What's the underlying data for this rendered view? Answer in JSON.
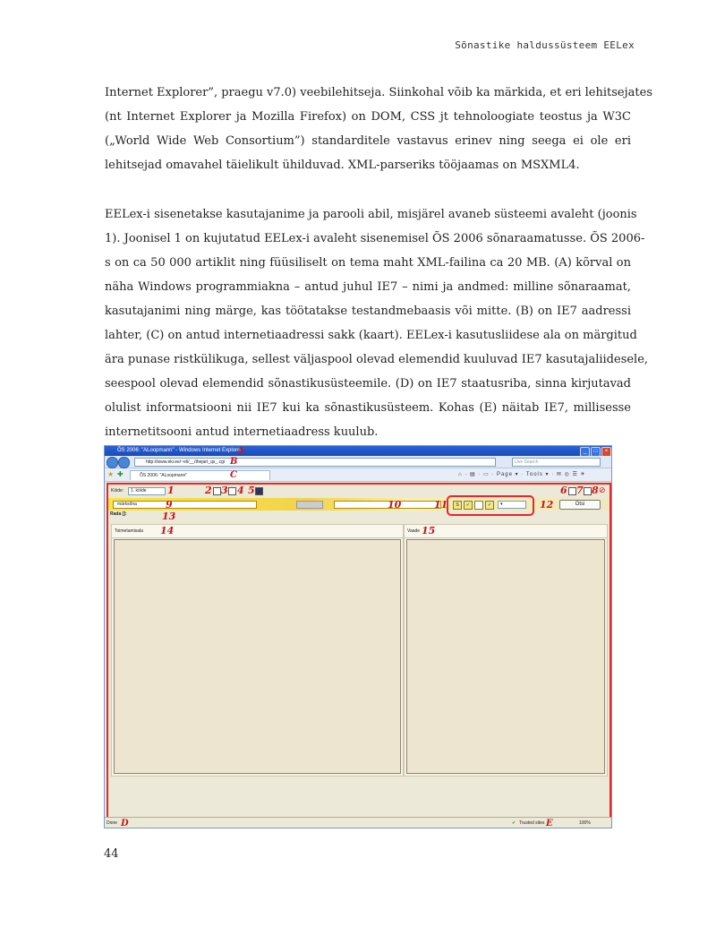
{
  "header": {
    "running_title": "Sõnastike haldussüsteem EELex"
  },
  "paragraph1": [
    "Internet Explorer”, praegu v7.0) veebilehitseja. Siinkohal võib ka märkida, et eri lehitsejates",
    "(nt Internet Explorer ja Mozilla Firefox) on DOM, CSS jt tehnoloogiate teostus ja W3C",
    "(„World Wide Web Consortium”) standarditele vastavus erinev ning seega ei ole eri",
    "lehitsejad omavahel täielikult ühilduvad. XML-parseriks tööjaamas on MSXML4."
  ],
  "paragraph2": [
    "EELex-i sisenetakse kasutajanime ja parooli abil, misjärel avaneb süsteemi avaleht (joonis",
    "1). Joonisel 1 on kujutatud EELex-i avaleht sisenemisel ÕS 2006 sõnaraamatusse. ÕS 2006-",
    "s on ca 50 000 artiklit ning füüsiliselt on tema maht XML-failina ca 20 MB. (A) kõrval on",
    "näha Windows programmiakna – antud juhul IE7 – nimi ja andmed: milline sõnaraamat,",
    "kasutajanimi ning märge, kas töötatakse testandmebaasis või mitte. (B) on IE7 aadressi",
    "lahter, (C) on antud internetiaadressi sakk (kaart). EELex-i kasutusliidese ala on märgitud",
    "ära punase ristkülikuga, sellest väljaspool olevad elemendid kuuluvad IE7 kasutajaliidesele,",
    "seespool olevad elemendid sõnastikusüsteemile. (D) on IE7 staatusriba, sinna kirjutavad",
    "olulist informatsiooni nii IE7 kui ka sõnastikusüsteem. Kohas (E) näitab IE7, millisesse",
    "internetitsooni antud internetiaadress kuulub."
  ],
  "figure": {
    "window_title": "ÕS 2006: \"ALoopmann\" - Windows Internet Explorer",
    "url": "http://www.eki.ee/~eli/__/thejart_qs_.cgi",
    "search_placeholder": "Live Search",
    "tab_label": "ÕS 2006: \"ALoopmann\"",
    "tab_icons": "⌂ · ▤ · ▭ · Page ▾ · Tools ▾ · ✉ ◎ ☰ ✈",
    "kaide_label": "Köide:",
    "kaide_value": "1. köide",
    "search_value": "märksõna",
    "otsi_label": "Otsi",
    "rada_label": "Rada []:",
    "left_panel_title": "Toimetamisala",
    "right_panel_title": "Vaade",
    "status_left": "Done",
    "status_zone": "Trusted sites",
    "status_zoom": "100%",
    "markers": {
      "A": "A",
      "B": "B",
      "C": "C",
      "D": "D",
      "E": "E",
      "n1": "1",
      "n2": "2",
      "n3": "3",
      "n4": "4",
      "n5": "5",
      "n6": "6",
      "n7": "7",
      "n8": "8",
      "n9": "9",
      "n10": "10",
      "n11": "11",
      "n12": "12",
      "n13": "13",
      "n14": "14",
      "n15": "15"
    }
  },
  "page_number": "44"
}
